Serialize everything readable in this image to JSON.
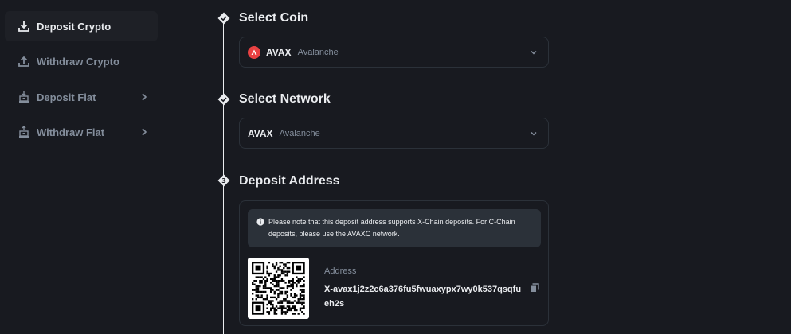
{
  "sidebar": {
    "items": [
      {
        "label": "Deposit Crypto",
        "icon": "download-icon",
        "active": true,
        "has_chevron": false
      },
      {
        "label": "Withdraw Crypto",
        "icon": "upload-icon",
        "active": false,
        "has_chevron": false
      },
      {
        "label": "Deposit Fiat",
        "icon": "bank-deposit-icon",
        "active": false,
        "has_chevron": true
      },
      {
        "label": "Withdraw Fiat",
        "icon": "bank-withdraw-icon",
        "active": false,
        "has_chevron": true
      }
    ]
  },
  "steps": [
    {
      "marker": "check",
      "title": "Select Coin"
    },
    {
      "marker": "check",
      "title": "Select Network"
    },
    {
      "marker": "3",
      "title": "Deposit Address"
    }
  ],
  "coin_select": {
    "symbol": "AVAX",
    "name": "Avalanche",
    "logo_color": "#e84142"
  },
  "network_select": {
    "symbol": "AVAX",
    "name": "Avalanche"
  },
  "deposit": {
    "notice_line1": "Please note that this deposit address supports X-Chain deposits. For C-Chain",
    "notice_line2": "deposits, please use the AVAXC network.",
    "address_label": "Address",
    "address_value": "X-avax1j2z2c6a376fu5fwuaxypx7wy0k537qsqfueh2s"
  },
  "colors": {
    "background": "#181a20",
    "panel_border": "#2b3139",
    "text_primary": "#eaecef",
    "text_secondary": "#848e9c",
    "accent_red": "#e84142"
  }
}
